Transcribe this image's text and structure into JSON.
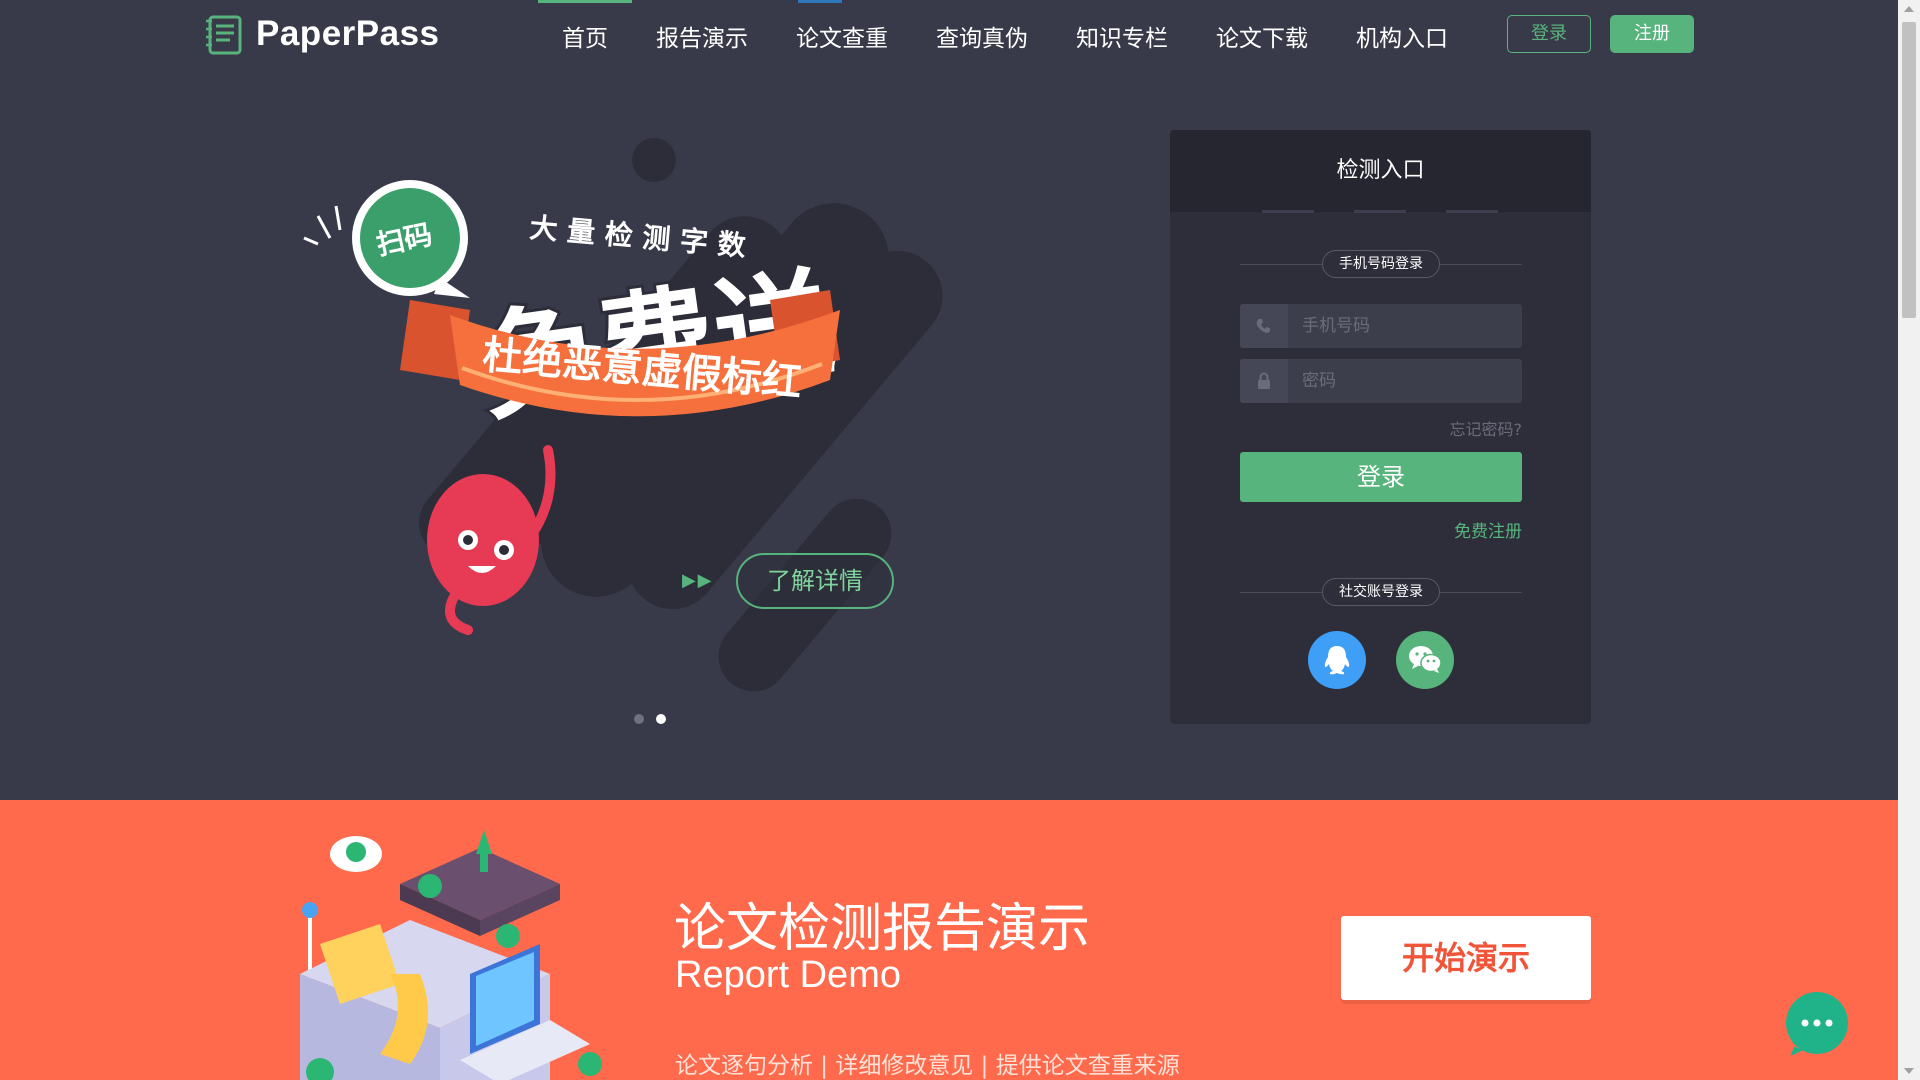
{
  "brand": {
    "name": "PaperPass"
  },
  "nav": {
    "items": [
      {
        "label": "首页"
      },
      {
        "label": "报告演示"
      },
      {
        "label": "论文查重"
      },
      {
        "label": "查询真伪"
      },
      {
        "label": "知识专栏"
      },
      {
        "label": "论文下载"
      },
      {
        "label": "机构入口"
      }
    ],
    "login_label": "登录",
    "register_label": "注册"
  },
  "hero": {
    "headline_top": "大 量 检 测 字 数",
    "headline_main": "免费送",
    "ribbon_text": "杜绝恶意虚假标红",
    "bubble_text": "扫码",
    "learn_more_label": "了解详情",
    "arrows": "▶ ▶",
    "slides_total": 2,
    "active_slide": 2
  },
  "login_panel": {
    "title": "检测入口",
    "phone_section_label": "手机号码登录",
    "phone_placeholder": "手机号码",
    "password_placeholder": "密码",
    "forgot_label": "忘记密码?",
    "submit_label": "登录",
    "free_register_label": "免费注册",
    "social_section_label": "社交账号登录",
    "social": [
      {
        "name": "qq-icon"
      },
      {
        "name": "wechat-icon"
      }
    ]
  },
  "demo_band": {
    "title": "论文检测报告演示",
    "subtitle": "Report Demo",
    "description": "论文逐句分析 | 详细修改意见 | 提供论文查重来源",
    "button_label": "开始演示"
  },
  "colors": {
    "background": "#393a49",
    "accent_green": "#56b47c",
    "band_orange": "#ff6a4c",
    "panel": "#2d2e3a",
    "chat": "#20b38a"
  }
}
